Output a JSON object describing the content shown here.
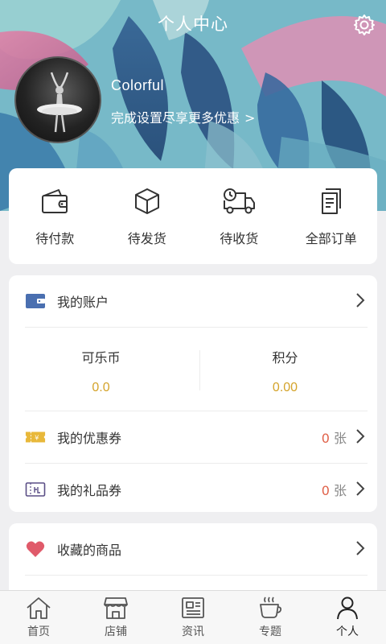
{
  "header": {
    "title": "个人中心",
    "settings_icon": "gear-icon"
  },
  "profile": {
    "username": "Colorful",
    "promo_text": "完成设置尽享更多优惠",
    "promo_chevron": ">"
  },
  "orders": [
    {
      "label": "待付款",
      "icon": "wallet-icon"
    },
    {
      "label": "待发货",
      "icon": "box-icon"
    },
    {
      "label": "待收货",
      "icon": "truck-icon"
    },
    {
      "label": "全部订单",
      "icon": "orders-list-icon"
    }
  ],
  "account": {
    "label": "我的账户",
    "icon": "wallet-card-icon",
    "balances": [
      {
        "label": "可乐币",
        "value": "0.0"
      },
      {
        "label": "积分",
        "value": "0.00"
      }
    ],
    "coupons": {
      "label": "我的优惠券",
      "count": "0",
      "unit": "张",
      "icon": "coupon-icon"
    },
    "gift_cards": {
      "label": "我的礼品券",
      "count": "0",
      "unit": "张",
      "icon": "gift-voucher-icon"
    }
  },
  "favorites": {
    "label": "收藏的商品",
    "icon": "heart-icon"
  },
  "tabbar": [
    {
      "label": "首页",
      "icon": "home-icon",
      "active": false
    },
    {
      "label": "店铺",
      "icon": "store-icon",
      "active": false
    },
    {
      "label": "资讯",
      "icon": "news-icon",
      "active": false
    },
    {
      "label": "专题",
      "icon": "coffee-cup-icon",
      "active": false
    },
    {
      "label": "个人",
      "icon": "person-icon",
      "active": true
    }
  ],
  "colors": {
    "accent_gold": "#d4a32a",
    "count_red": "#e0624a",
    "heart_red": "#e05a6a",
    "wallet_blue": "#4a6fb0"
  }
}
